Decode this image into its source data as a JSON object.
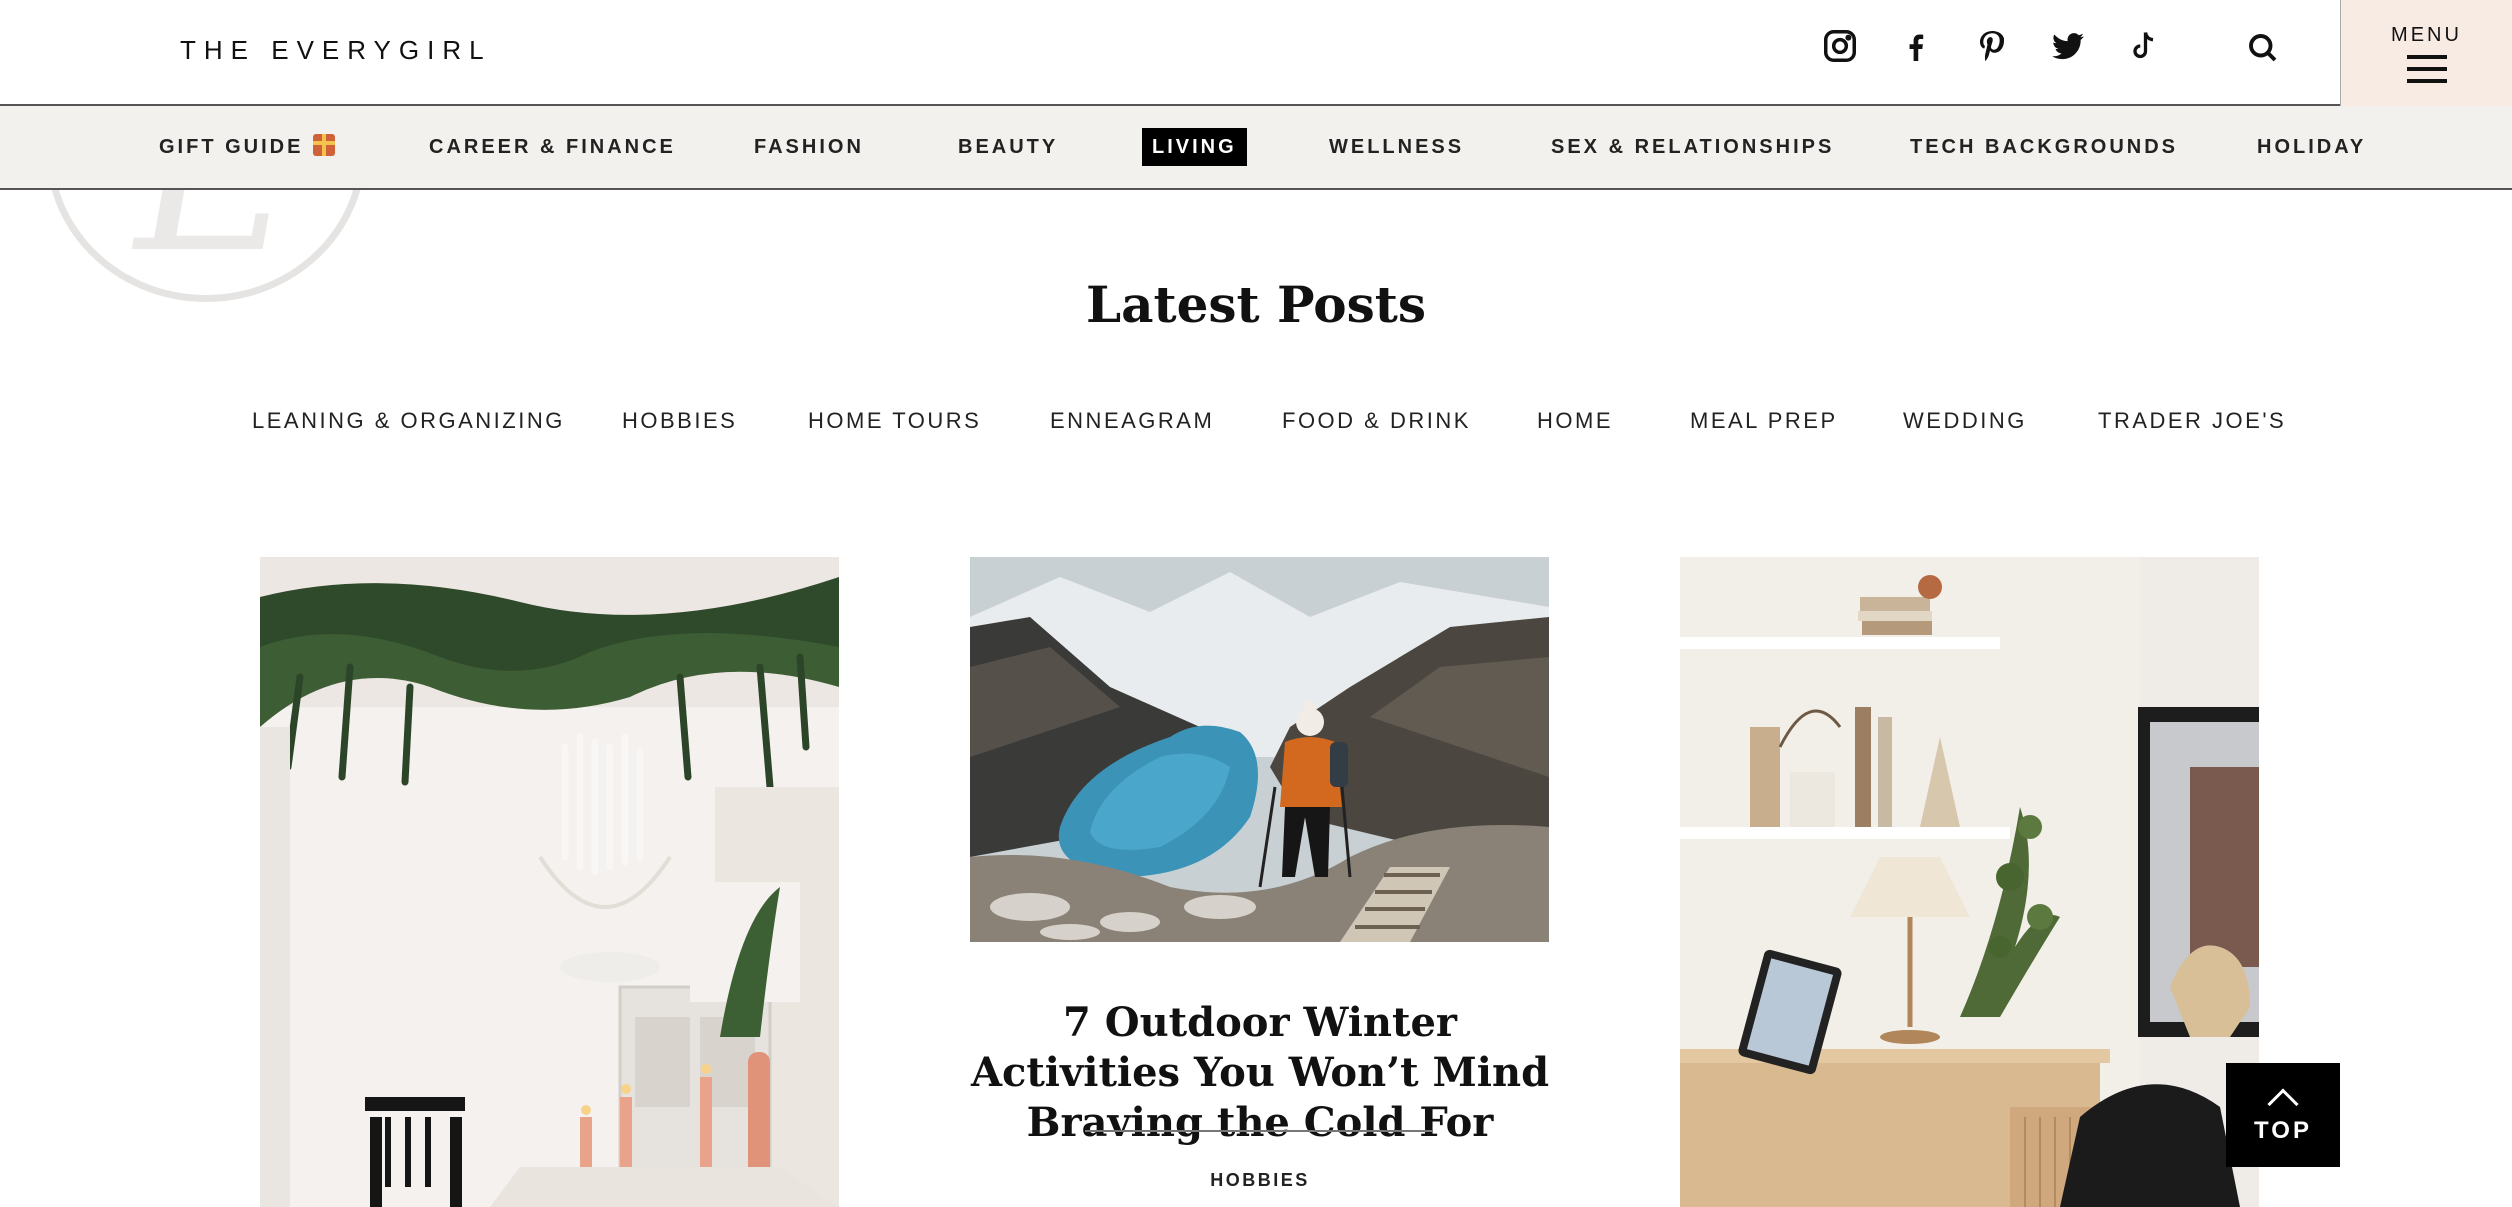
{
  "header": {
    "logo": "THE EVERYGIRL",
    "social_icons": [
      "instagram-icon",
      "facebook-icon",
      "pinterest-icon",
      "twitter-icon",
      "tiktok-icon"
    ],
    "search_icon": "search-icon",
    "menu_label": "MENU"
  },
  "nav": {
    "items": [
      {
        "label": "GIFT GUIDE",
        "icon": "gift-icon"
      },
      {
        "label": "CAREER & FINANCE"
      },
      {
        "label": "FASHION"
      },
      {
        "label": "BEAUTY"
      },
      {
        "label": "LIVING",
        "active": true
      },
      {
        "label": "WELLNESS"
      },
      {
        "label": "SEX & RELATIONSHIPS"
      },
      {
        "label": "TECH BACKGROUNDS"
      },
      {
        "label": "HOLIDAY"
      }
    ]
  },
  "main": {
    "section_title": "Latest Posts",
    "subcategories": [
      "LEANING & ORGANIZING",
      "HOBBIES",
      "HOME TOURS",
      "ENNEAGRAM",
      "FOOD & DRINK",
      "HOME",
      "MEAL PREP",
      "WEDDING",
      "TRADER JOE'S"
    ],
    "cards": [
      {
        "image": "holiday-dining-room-photo"
      },
      {
        "image": "winter-hiker-mountain-lake-photo",
        "title": "7 Outdoor Winter Activities You Won’t Mind Braving the Cold For",
        "category": "HOBBIES"
      },
      {
        "image": "home-office-desk-photo"
      }
    ]
  },
  "back_to_top": {
    "label": "TOP"
  }
}
